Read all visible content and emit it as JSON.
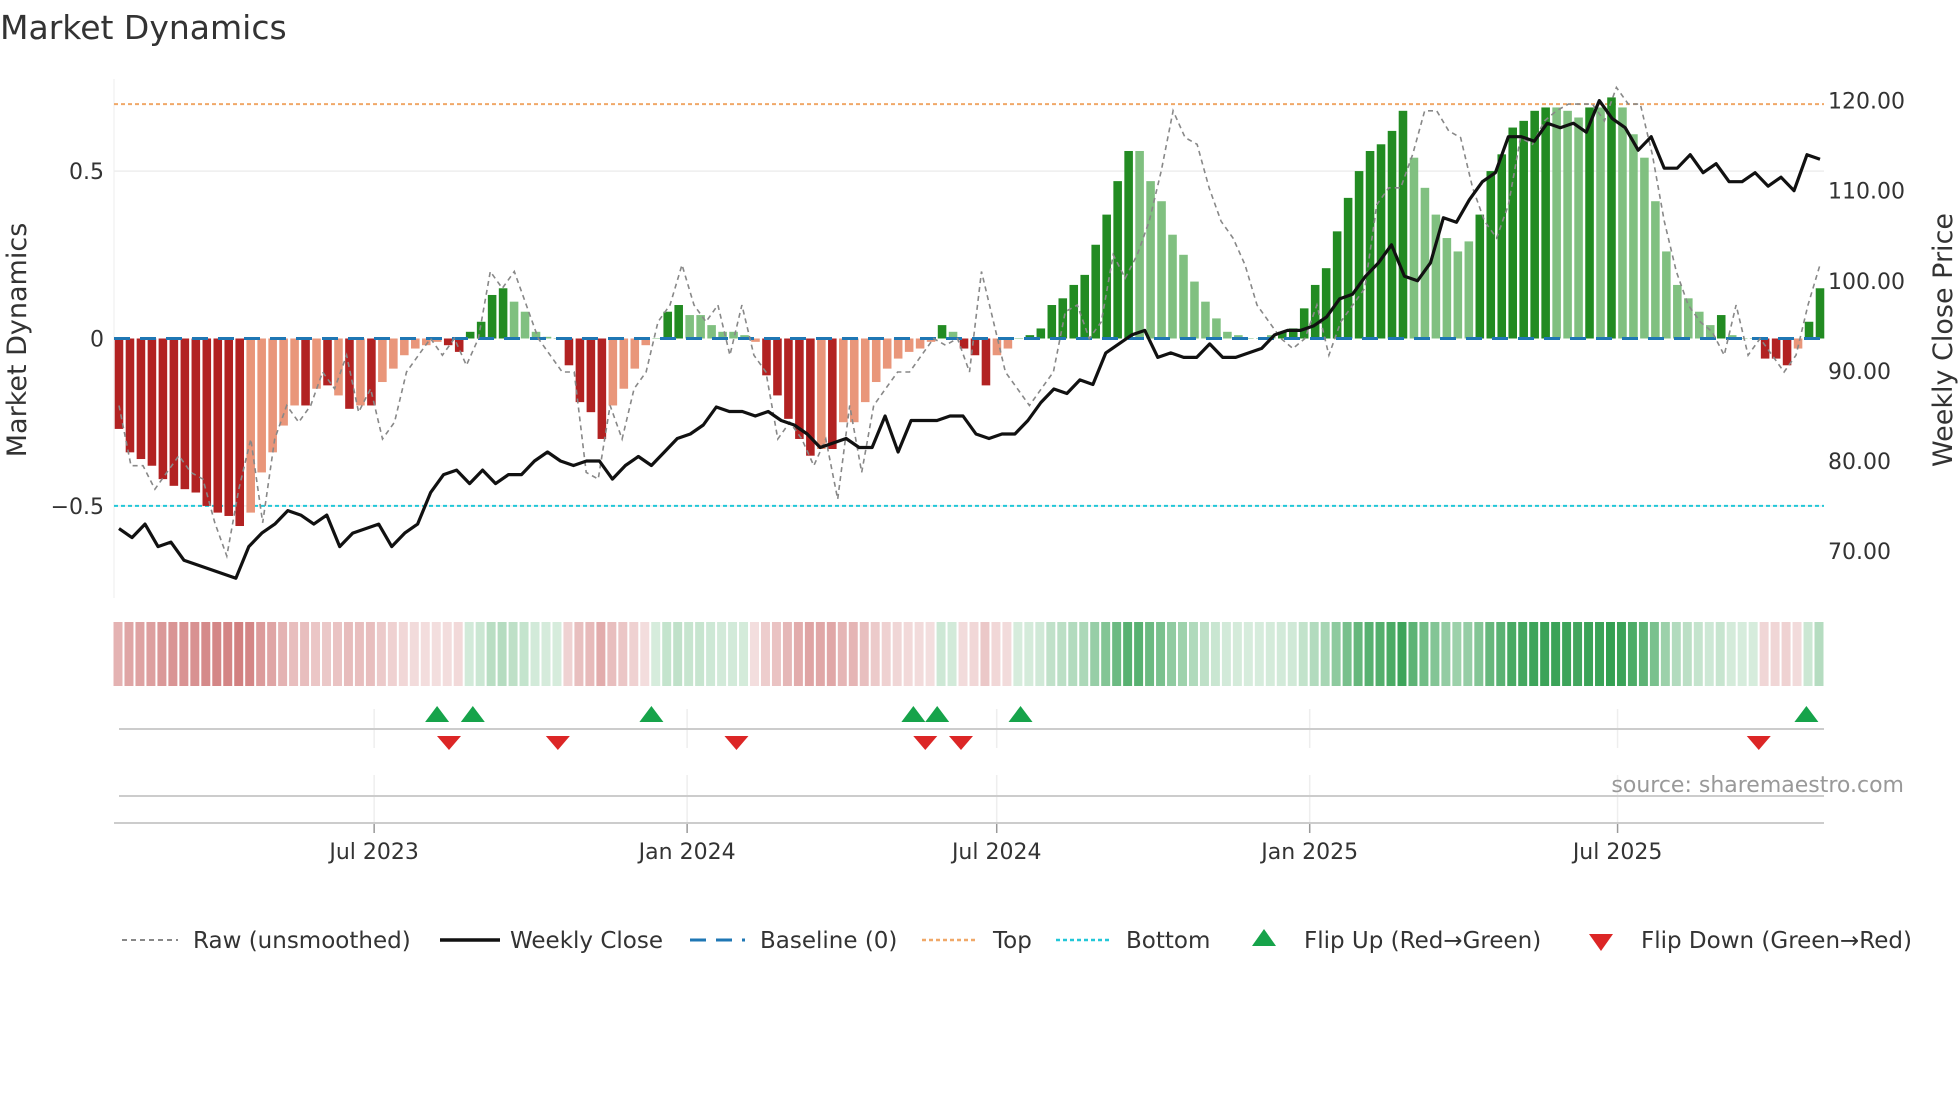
{
  "chart_data": {
    "type": "bar",
    "title": "Market Dynamics",
    "ylabel": "Market Dynamics",
    "y2label": "Weekly Close Price",
    "ylim": [
      -0.775,
      0.775
    ],
    "y2lim": [
      64.8,
      122.4
    ],
    "yticks": [
      {
        "v": 0.5,
        "label": "0.5"
      },
      {
        "v": 0,
        "label": "0"
      },
      {
        "v": -0.5,
        "label": "−0.5"
      }
    ],
    "y2ticks": [
      {
        "v": 120,
        "label": "120.00"
      },
      {
        "v": 110,
        "label": "110.00"
      },
      {
        "v": 100,
        "label": "100.00"
      },
      {
        "v": 90,
        "label": "90.00"
      },
      {
        "v": 80,
        "label": "80.00"
      },
      {
        "v": 70,
        "label": "70.00"
      }
    ],
    "xrange": [
      "2023-02-01",
      "2025-10-28"
    ],
    "xticks": [
      {
        "date": "2023-07-01",
        "label": "Jul 2023"
      },
      {
        "date": "2024-01-01",
        "label": "Jan 2024"
      },
      {
        "date": "2024-07-01",
        "label": "Jul 2024"
      },
      {
        "date": "2025-01-01",
        "label": "Jan 2025"
      },
      {
        "date": "2025-07-01",
        "label": "Jul 2025"
      }
    ],
    "levels": {
      "baseline": 0,
      "top": 0.7,
      "bottom": -0.5
    },
    "colors": {
      "strong_red": "#b22222",
      "weak_red": "#e9967a",
      "strong_green": "#228b22",
      "weak_green": "#80c080",
      "close": "#111111",
      "raw": "#888888",
      "baseline": "#1f77b4",
      "top": "#f0a868",
      "bottom": "#22c7d8",
      "flip_up": "#16a34a",
      "flip_down": "#dc2626"
    },
    "bars": {
      "values": [
        -0.27,
        -0.34,
        -0.36,
        -0.38,
        -0.42,
        -0.44,
        -0.45,
        -0.46,
        -0.5,
        -0.52,
        -0.53,
        -0.56,
        -0.52,
        -0.4,
        -0.34,
        -0.26,
        -0.2,
        -0.2,
        -0.15,
        -0.14,
        -0.17,
        -0.21,
        -0.2,
        -0.2,
        -0.13,
        -0.09,
        -0.05,
        -0.03,
        -0.02,
        -0.01,
        -0.02,
        -0.04,
        0.02,
        0.05,
        0.13,
        0.15,
        0.11,
        0.08,
        0.02,
        0.005,
        0.0,
        -0.08,
        -0.19,
        -0.22,
        -0.3,
        -0.2,
        -0.15,
        -0.09,
        -0.02,
        0.0,
        0.08,
        0.1,
        0.07,
        0.07,
        0.04,
        0.02,
        0.02,
        0.01,
        -0.01,
        -0.11,
        -0.17,
        -0.24,
        -0.3,
        -0.35,
        -0.33,
        -0.33,
        -0.25,
        -0.25,
        -0.19,
        -0.13,
        -0.09,
        -0.06,
        -0.04,
        -0.03,
        -0.01,
        0.04,
        0.02,
        -0.03,
        -0.05,
        -0.14,
        -0.05,
        -0.03,
        0.0,
        0.01,
        0.03,
        0.1,
        0.12,
        0.16,
        0.19,
        0.28,
        0.37,
        0.47,
        0.56,
        0.56,
        0.47,
        0.41,
        0.31,
        0.25,
        0.17,
        0.11,
        0.06,
        0.02,
        0.01,
        0.0,
        0.0,
        0.01,
        0.02,
        0.03,
        0.09,
        0.16,
        0.21,
        0.32,
        0.42,
        0.5,
        0.56,
        0.58,
        0.62,
        0.68,
        0.54,
        0.45,
        0.37,
        0.3,
        0.26,
        0.29,
        0.37,
        0.5,
        0.55,
        0.63,
        0.65,
        0.68,
        0.69,
        0.69,
        0.68,
        0.66,
        0.69,
        0.69,
        0.72,
        0.69,
        0.61,
        0.54,
        0.41,
        0.26,
        0.16,
        0.12,
        0.08,
        0.04,
        0.07,
        0.01,
        0.0,
        0.0,
        -0.06,
        -0.06,
        -0.08,
        -0.03,
        0.05,
        0.15
      ],
      "strong": [
        1,
        1,
        1,
        1,
        1,
        1,
        1,
        1,
        1,
        1,
        1,
        1,
        0,
        0,
        0,
        0,
        0,
        1,
        0,
        1,
        0,
        1,
        0,
        1,
        0,
        0,
        0,
        0,
        0,
        0,
        1,
        1,
        1,
        1,
        1,
        1,
        0,
        0,
        0,
        0,
        0,
        1,
        1,
        1,
        1,
        0,
        0,
        0,
        0,
        0,
        1,
        1,
        0,
        0,
        0,
        0,
        0,
        0,
        0,
        1,
        1,
        1,
        1,
        1,
        0,
        1,
        0,
        0,
        0,
        0,
        0,
        0,
        0,
        0,
        0,
        1,
        0,
        1,
        1,
        1,
        0,
        0,
        0,
        1,
        1,
        1,
        1,
        1,
        1,
        1,
        1,
        1,
        1,
        0,
        0,
        0,
        0,
        0,
        0,
        0,
        0,
        0,
        0,
        0,
        0,
        0,
        1,
        1,
        1,
        1,
        1,
        1,
        1,
        1,
        1,
        1,
        1,
        1,
        0,
        0,
        0,
        0,
        0,
        0,
        1,
        1,
        1,
        1,
        1,
        1,
        1,
        0,
        0,
        0,
        1,
        0,
        1,
        0,
        0,
        0,
        0,
        0,
        0,
        0,
        0,
        0,
        1,
        0,
        0,
        0,
        1,
        1,
        1,
        0,
        1,
        1
      ]
    },
    "weekly_close": [
      72.5,
      71.5,
      73,
      70.5,
      71,
      69,
      68.5,
      68,
      67.5,
      67,
      70.5,
      72,
      73,
      74.5,
      74,
      73,
      74,
      70.5,
      72,
      72.5,
      73,
      70.5,
      72,
      73,
      76.5,
      78.5,
      79,
      77.5,
      79,
      77.5,
      78.5,
      78.5,
      80,
      81,
      80,
      79.5,
      80,
      80,
      78,
      79.5,
      80.5,
      79.5,
      81,
      82.5,
      83,
      84,
      86,
      85.5,
      85.5,
      85,
      85.5,
      84.5,
      84,
      83,
      81.5,
      82,
      82.5,
      81.5,
      81.5,
      85,
      81,
      84.5,
      84.5,
      84.5,
      85,
      85,
      83,
      82.5,
      83,
      83,
      84.5,
      86.5,
      88,
      87.5,
      89,
      88.5,
      92,
      93,
      94,
      94.5,
      91.5,
      92,
      91.5,
      91.5,
      93,
      91.5,
      91.5,
      92,
      92.5,
      94,
      94.5,
      94.5,
      95,
      96,
      98,
      98.5,
      100.5,
      102,
      104,
      100.5,
      100,
      102,
      107,
      106.5,
      109,
      111,
      112,
      116,
      116,
      115.5,
      117.5,
      117,
      117.5,
      116.5,
      120,
      118,
      117,
      114.5,
      116,
      112.5,
      112.5,
      114,
      112,
      113,
      111,
      111,
      112,
      110.5,
      111.5,
      110,
      114,
      113.5
    ],
    "raw": [
      -0.2,
      -0.38,
      -0.38,
      -0.45,
      -0.4,
      -0.35,
      -0.4,
      -0.42,
      -0.55,
      -0.65,
      -0.45,
      -0.3,
      -0.55,
      -0.3,
      -0.2,
      -0.25,
      -0.2,
      -0.1,
      -0.15,
      -0.05,
      -0.22,
      -0.15,
      -0.3,
      -0.25,
      -0.1,
      -0.05,
      0.0,
      -0.05,
      0.0,
      -0.08,
      0.0,
      0.2,
      0.15,
      0.2,
      0.1,
      0.0,
      -0.05,
      -0.1,
      -0.1,
      -0.4,
      -0.42,
      -0.2,
      -0.3,
      -0.15,
      -0.1,
      0.05,
      0.1,
      0.22,
      0.1,
      0.05,
      0.1,
      -0.05,
      0.1,
      -0.05,
      -0.1,
      -0.3,
      -0.25,
      -0.3,
      -0.38,
      -0.3,
      -0.48,
      -0.2,
      -0.4,
      -0.2,
      -0.15,
      -0.1,
      -0.1,
      -0.05,
      0.0,
      -0.02,
      0.0,
      -0.1,
      0.2,
      0.05,
      -0.1,
      -0.15,
      -0.2,
      -0.15,
      -0.1,
      0.08,
      0.1,
      0.0,
      0.05,
      0.25,
      0.18,
      0.25,
      0.35,
      0.5,
      0.68,
      0.6,
      0.58,
      0.45,
      0.35,
      0.3,
      0.22,
      0.1,
      0.05,
      0.0,
      -0.03,
      0.0,
      0.1,
      -0.05,
      0.05,
      0.1,
      0.15,
      0.4,
      0.45,
      0.45,
      0.55,
      0.68,
      0.68,
      0.62,
      0.6,
      0.45,
      0.35,
      0.3,
      0.4,
      0.6,
      0.58,
      0.65,
      0.68,
      0.7,
      0.7,
      0.7,
      0.65,
      0.75,
      0.7,
      0.7,
      0.55,
      0.35,
      0.2,
      0.1,
      0.05,
      0.02,
      -0.05,
      0.1,
      -0.05,
      0.0,
      -0.05,
      -0.1,
      -0.05,
      0.1,
      0.22
    ],
    "flips_up": [
      "2023-08-07",
      "2023-08-28",
      "2023-12-11",
      "2024-05-13",
      "2024-05-27",
      "2024-07-15",
      "2025-10-20"
    ],
    "flips_down": [
      "2023-08-14",
      "2023-10-17",
      "2024-01-30",
      "2024-05-20",
      "2024-06-10",
      "2025-09-22"
    ],
    "legend": {
      "raw": "Raw (unsmoothed)",
      "close": "Weekly Close",
      "baseline": "Baseline (0)",
      "top": "Top",
      "bottom": "Bottom",
      "flip_up": "Flip Up (Red→Green)",
      "flip_down": "Flip Down (Green→Red)"
    },
    "legend_position": "bottom",
    "source": "source: sharemaestro.com"
  }
}
